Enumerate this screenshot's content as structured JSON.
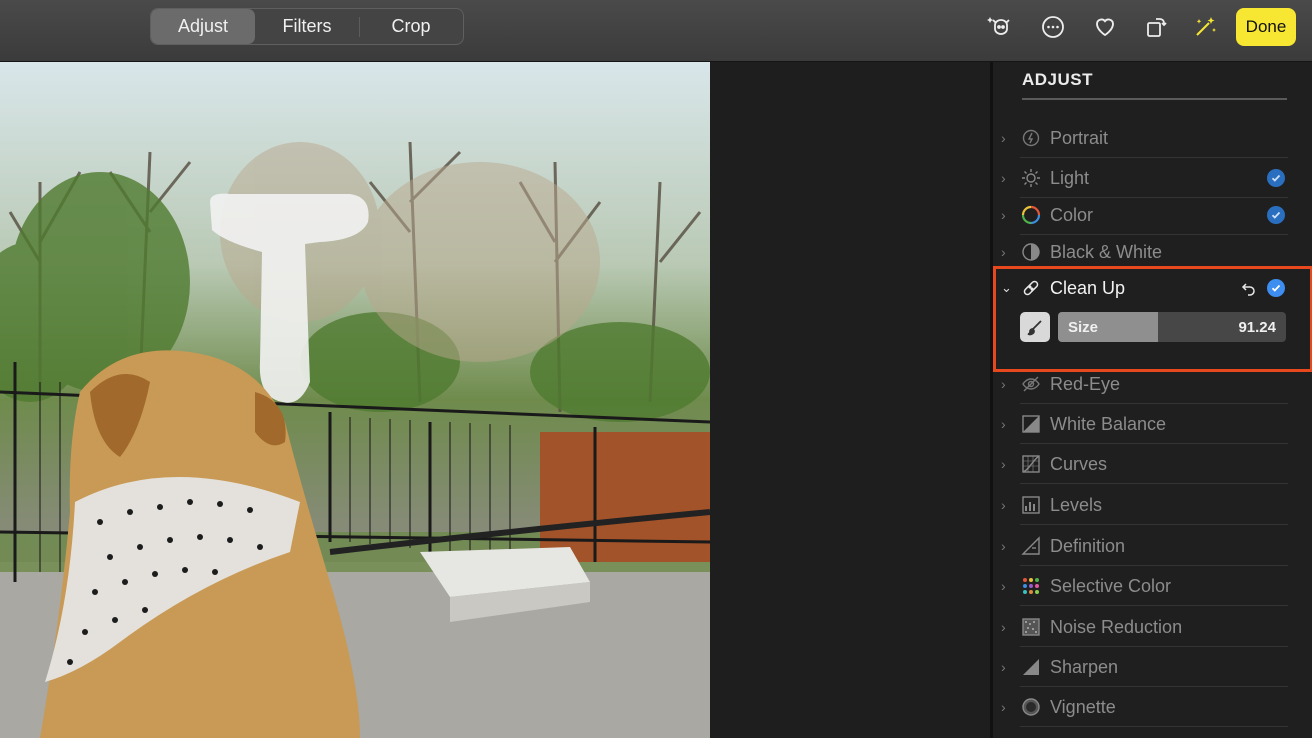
{
  "toolbar": {
    "tabs": [
      {
        "label": "Adjust",
        "active": true
      },
      {
        "label": "Filters",
        "active": false
      },
      {
        "label": "Crop",
        "active": false
      }
    ],
    "icons": [
      "magic-pet-icon",
      "more-icon",
      "heart-icon",
      "rotate-icon",
      "auto-enhance-icon"
    ],
    "done_label": "Done",
    "done_color": "#f7e632"
  },
  "sidebar": {
    "title": "ADJUST",
    "items": [
      {
        "label": "Portrait",
        "icon": "portrait-icon",
        "checked": false
      },
      {
        "label": "Light",
        "icon": "sun-icon",
        "checked": true
      },
      {
        "label": "Color",
        "icon": "color-wheel-icon",
        "checked": true
      },
      {
        "label": "Black & White",
        "icon": "half-circle-icon",
        "checked": false
      },
      {
        "label": "Clean Up",
        "icon": "bandage-icon",
        "checked": true,
        "expanded": true
      },
      {
        "label": "Red-Eye",
        "icon": "eye-icon",
        "checked": false
      },
      {
        "label": "White Balance",
        "icon": "white-balance-icon",
        "checked": false
      },
      {
        "label": "Curves",
        "icon": "curves-icon",
        "checked": false
      },
      {
        "label": "Levels",
        "icon": "levels-icon",
        "checked": false
      },
      {
        "label": "Definition",
        "icon": "definition-icon",
        "checked": false
      },
      {
        "label": "Selective Color",
        "icon": "selective-color-icon",
        "checked": false
      },
      {
        "label": "Noise Reduction",
        "icon": "noise-icon",
        "checked": false
      },
      {
        "label": "Sharpen",
        "icon": "sharpen-icon",
        "checked": false
      },
      {
        "label": "Vignette",
        "icon": "vignette-icon",
        "checked": false
      }
    ],
    "cleanup": {
      "size_label": "Size",
      "size_value": "91.24",
      "size_fraction": 0.44
    }
  },
  "colors": {
    "accent_check": "#2a6fbf",
    "highlight_box": "#e8481e"
  }
}
